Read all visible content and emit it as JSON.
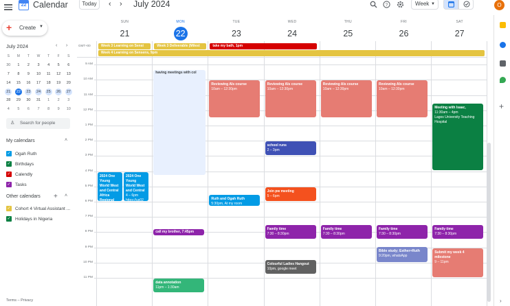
{
  "header": {
    "app_title": "Calendar",
    "logo_day": "22",
    "today_label": "Today",
    "prev_icon": "chevron-left-icon",
    "next_icon": "chevron-right-icon",
    "month_title": "July 2024",
    "view_label": "Week",
    "avatar_letter": "O"
  },
  "sidebar": {
    "create_label": "Create",
    "mini_month": "July 2024",
    "mini_headers": [
      "S",
      "M",
      "T",
      "W",
      "T",
      "F",
      "S"
    ],
    "mini_weeks": [
      [
        "30",
        "1",
        "2",
        "3",
        "4",
        "5",
        "6"
      ],
      [
        "7",
        "8",
        "9",
        "10",
        "11",
        "12",
        "13"
      ],
      [
        "14",
        "15",
        "16",
        "17",
        "18",
        "19",
        "20"
      ],
      [
        "21",
        "22",
        "23",
        "24",
        "25",
        "26",
        "27"
      ],
      [
        "28",
        "29",
        "30",
        "31",
        "1",
        "2",
        "3"
      ],
      [
        "4",
        "5",
        "6",
        "7",
        "8",
        "9",
        "10"
      ]
    ],
    "search_people": "Search for people",
    "my_calendars_title": "My calendars",
    "my_calendars": [
      {
        "label": "Ogah Ruth",
        "color": "#039be5"
      },
      {
        "label": "Birthdays",
        "color": "#0b8043"
      },
      {
        "label": "Calendly",
        "color": "#d50000"
      },
      {
        "label": "Tasks",
        "color": "#8e24aa"
      }
    ],
    "other_calendars_title": "Other calendars",
    "other_calendars": [
      {
        "label": "Cohort 4 Virtual Assistant ...",
        "color": "#e4c441"
      },
      {
        "label": "Holidays in Nigeria",
        "color": "#0b8043"
      }
    ],
    "footer": "Terms – Privacy"
  },
  "week": {
    "days": [
      {
        "name": "SUN",
        "date": "21"
      },
      {
        "name": "MON",
        "date": "22"
      },
      {
        "name": "TUE",
        "date": "23"
      },
      {
        "name": "WED",
        "date": "24"
      },
      {
        "name": "THU",
        "date": "25"
      },
      {
        "name": "FRI",
        "date": "26"
      },
      {
        "name": "SAT",
        "date": "27"
      }
    ],
    "timezone": "GMT+00",
    "hour_labels": [
      "9 AM",
      "10 AM",
      "11 AM",
      "12 PM",
      "1 PM",
      "2 PM",
      "3 PM",
      "4 PM",
      "5 PM",
      "6 PM",
      "7 PM",
      "8 PM",
      "9 PM",
      "10 PM",
      "11 PM"
    ]
  },
  "allday_events": [
    {
      "title": "Week 3 Learning on Sensi",
      "color": "#e4c441"
    },
    {
      "title": "Week 3 Deliverable (Milest",
      "color": "#e4c441"
    },
    {
      "title": "take my bath, 1pm",
      "color": "#d50000"
    },
    {
      "title": "Week 4 Learning on Sensens, 9pm",
      "color": "#e4c441"
    }
  ],
  "events": [
    {
      "title": "having meetings with col",
      "time": ""
    },
    {
      "title": "Reviewing AIs course",
      "time": "10am – 12:30pm"
    },
    {
      "title": "Reviewing AIs course",
      "time": "10am – 12:30pm"
    },
    {
      "title": "Reviewing AIs course",
      "time": "10am – 12:30pm"
    },
    {
      "title": "Reviewing AIs course",
      "time": "10am – 12:30pm"
    },
    {
      "title": "Meeting with Isaac,",
      "time": "11:30am – 4pm",
      "extra": "Lagos University Teaching Hospital"
    },
    {
      "title": "school runs",
      "time": "2 – 3pm"
    },
    {
      "title": "2024 One Young World West and Central Africa Regional Summit with",
      "time": "4 – 6pm",
      "extra": "https://us02"
    },
    {
      "title": "2024 One Young World West and Central",
      "time": "4 – 6pm",
      "extra": "https://us02"
    },
    {
      "title": "Join pw meeting",
      "time": "5 – 6pm"
    },
    {
      "title": "Ruth and Ogah Ruth",
      "time": "5:30pm, At my room"
    },
    {
      "title": "call my brother, 7:45pm",
      "time": ""
    },
    {
      "title": "Family time",
      "time": "7:30 – 8:30pm"
    },
    {
      "title": "Family time",
      "time": "7:30 – 8:30pm"
    },
    {
      "title": "Family time",
      "time": "7:30 – 8:30pm"
    },
    {
      "title": "Family time",
      "time": "7:30 – 8:30pm"
    },
    {
      "title": "Submit my week 4 milestone",
      "time": "9 – 11pm"
    },
    {
      "title": "Bible study; Esther+Ruth",
      "time": "9:20pm, whatsApp"
    },
    {
      "title": "Colourful Ladies Hangout",
      "time": "10pm, google meet"
    },
    {
      "title": "data annotation",
      "time": "11pm – 1:30am"
    }
  ],
  "colors": {
    "accent": "#1a73e8",
    "salmon": "#e67c73",
    "purple": "#8e24aa",
    "blueberry": "#3f51b5",
    "tangerine": "#f4511e",
    "peacock": "#039be5",
    "basil": "#0b8043",
    "graphite": "#616161",
    "lavender": "#7986cb",
    "sage": "#33b679",
    "banana": "#e4c441",
    "tomato": "#d50000"
  }
}
